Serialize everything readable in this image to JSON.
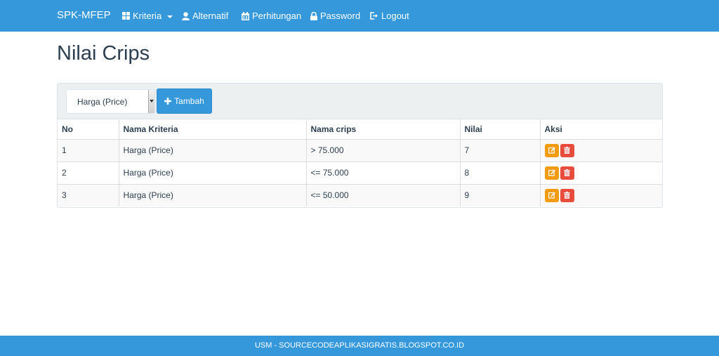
{
  "navbar": {
    "brand": "SPK-MFEP",
    "items": [
      {
        "label": "Kriteria",
        "icon": "th-large-icon",
        "dropdown": true
      },
      {
        "label": "Alternatif",
        "icon": "user-icon"
      },
      {
        "label": "Perhitungan",
        "icon": "calendar-icon"
      },
      {
        "label": "Password",
        "icon": "lock-icon"
      },
      {
        "label": "Logout",
        "icon": "log-out-icon"
      }
    ]
  },
  "page": {
    "title": "Nilai Crips"
  },
  "filter": {
    "selected": "Harga (Price)"
  },
  "toolbar": {
    "add_label": "Tambah"
  },
  "table": {
    "headers": [
      "No",
      "Nama Kriteria",
      "Nama crips",
      "Nilai",
      "Aksi"
    ],
    "rows": [
      {
        "no": "1",
        "kriteria": "Harga (Price)",
        "crips": "> 75.000",
        "nilai": "7"
      },
      {
        "no": "2",
        "kriteria": "Harga (Price)",
        "crips": "<= 75.000",
        "nilai": "8"
      },
      {
        "no": "3",
        "kriteria": "Harga (Price)",
        "crips": "<= 50.000",
        "nilai": "9"
      }
    ]
  },
  "footer": {
    "text": "USM - SOURCECODEAPLIKASIGRATIS.BLOGSPOT.CO.ID"
  },
  "colors": {
    "primary": "#3498db",
    "warning": "#f39c12",
    "danger": "#e74c3c",
    "text": "#2c3e50"
  }
}
